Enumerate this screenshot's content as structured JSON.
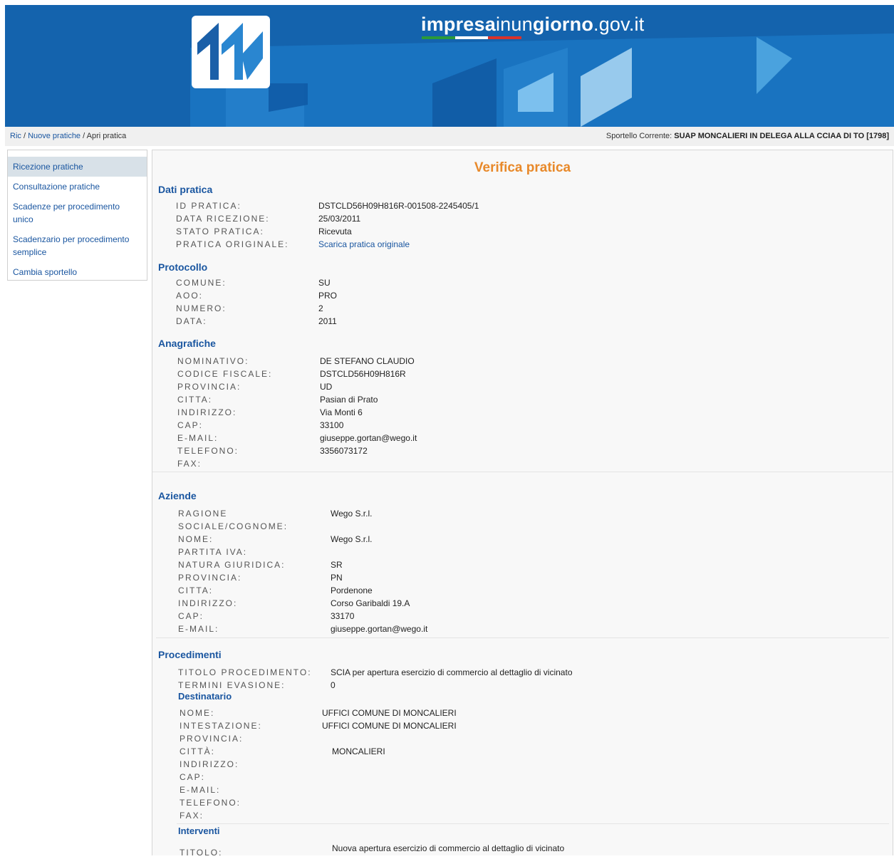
{
  "header": {
    "site_name_a": "impresa",
    "site_name_b": "inun",
    "site_name_c": "giorno",
    "site_name_d": ".gov.it"
  },
  "breadcrumb": {
    "ric": "Ric",
    "sep1": " / ",
    "nuove": "Nuove pratiche",
    "sep2": " / ",
    "current": "Apri pratica"
  },
  "sportello": {
    "label": "Sportello Corrente: ",
    "value": "SUAP MONCALIERI IN DELEGA ALLA CCIAA DI TO [1798]"
  },
  "sidebar": {
    "items": [
      {
        "label": "Ricezione pratiche"
      },
      {
        "label": "Consultazione pratiche"
      },
      {
        "label": "Scadenze per procedimento unico"
      },
      {
        "label": "Scadenzario per procedimento semplice"
      },
      {
        "label": "Cambia sportello"
      }
    ]
  },
  "main": {
    "title": "Verifica pratica",
    "dati_pratica": {
      "heading": "Dati pratica",
      "id_label": "ID PRATICA:",
      "id_value": "DSTCLD56H09H816R-001508-2245405/1",
      "data_label": "DATA RICEZIONE:",
      "data_value": "25/03/2011",
      "stato_label": "STATO PRATICA:",
      "stato_value": "Ricevuta",
      "orig_label": "PRATICA ORIGINALE:",
      "orig_value": "Scarica pratica originale"
    },
    "protocollo": {
      "heading": "Protocollo",
      "comune_label": "COMUNE:",
      "comune_value": "SU",
      "aoo_label": "AOO:",
      "aoo_value": "PRO",
      "numero_label": "NUMERO:",
      "numero_value": "2",
      "data_label": "DATA:",
      "data_value": "2011"
    },
    "anagrafiche": {
      "heading": "Anagrafiche",
      "nominativo_label": "NOMINATIVO:",
      "nominativo_value": "DE STEFANO CLAUDIO",
      "cf_label": "CODICE FISCALE:",
      "cf_value": "DSTCLD56H09H816R",
      "provincia_label": "PROVINCIA:",
      "provincia_value": "UD",
      "citta_label": "CITTA:",
      "citta_value": "Pasian di Prato",
      "indirizzo_label": "INDIRIZZO:",
      "indirizzo_value": "Via Monti 6",
      "cap_label": "CAP:",
      "cap_value": "33100",
      "email_label": "E-MAIL:",
      "email_value": "giuseppe.gortan@wego.it",
      "telefono_label": "TELEFONO:",
      "telefono_value": "3356073172",
      "fax_label": "FAX:"
    },
    "aziende": {
      "heading": "Aziende",
      "ragione_label_1": "RAGIONE",
      "ragione_label_2": "SOCIALE/COGNOME:",
      "ragione_value": "Wego S.r.l.",
      "nome_label": "NOME:",
      "nome_value": "Wego S.r.l.",
      "piva_label": "PARTITA IVA:",
      "natura_label": "NATURA GIURIDICA:",
      "natura_value": "SR",
      "provincia_label": "PROVINCIA:",
      "provincia_value": "PN",
      "citta_label": "CITTA:",
      "citta_value": "Pordenone",
      "indirizzo_label": "INDIRIZZO:",
      "indirizzo_value": "Corso Garibaldi 19.A",
      "cap_label": "CAP:",
      "cap_value": "33170",
      "email_label": "E-MAIL:",
      "email_value": "giuseppe.gortan@wego.it"
    },
    "procedimenti": {
      "heading": "Procedimenti",
      "titolo_label": "TITOLO PROCEDIMENTO:",
      "titolo_value": "SCIA per apertura esercizio di commercio al dettaglio di vicinato",
      "termini_label": "TERMINI EVASIONE:",
      "termini_value": "0",
      "destinatario": {
        "heading": "Destinatario",
        "nome_label": "NOME:",
        "nome_value": "UFFICI COMUNE DI MONCALIERI",
        "intestazione_label": "INTESTAZIONE:",
        "intestazione_value": "UFFICI COMUNE DI MONCALIERI",
        "provincia_label": "PROVINCIA:",
        "citta_label": "CITTÀ:",
        "citta_value": "MONCALIERI",
        "indirizzo_label": "INDIRIZZO:",
        "cap_label": "CAP:",
        "email_label": "E-MAIL:",
        "telefono_label": "TELEFONO:",
        "fax_label": "FAX:"
      },
      "interventi": {
        "heading": "Interventi",
        "titolo_label": "TITOLO:",
        "titolo_value": "Nuova apertura esercizio di commercio al dettaglio di vicinato"
      }
    }
  }
}
